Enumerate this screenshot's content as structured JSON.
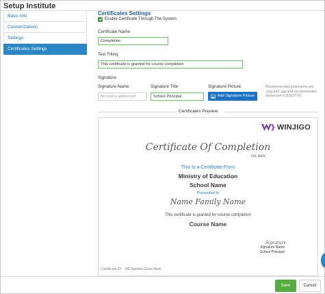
{
  "page": {
    "title": "Setup Institute"
  },
  "sidebar": {
    "items": [
      {
        "label": "Basic Info"
      },
      {
        "label": "Customizations"
      },
      {
        "label": "Settings"
      },
      {
        "label": "Certificates Settings",
        "active": true
      }
    ]
  },
  "certificates": {
    "section_title": "Certificates Settings",
    "enable_label": "Enable Certificate Through The System",
    "enable_checked": true,
    "certificate_name_label": "Certificate Name",
    "certificate_name_value": "Completion",
    "text_filling_label": "Text Filling",
    "text_filling_value": "This certificate is granted for course completion",
    "signature_section_label": "Signature",
    "signature_name_label": "Signature Name",
    "signature_name_placeholder": "No text is added yet",
    "signature_title_label": "Signature Title",
    "signature_title_value": "School Principal",
    "signature_picture_label": "Signature Picture",
    "add_signature_button": "Add Signature Picture",
    "hint": "Recommended extensions are .png and .jpg and recommended dimension is 83x37 PX"
  },
  "preview": {
    "label": "Certificates Preview",
    "logo_text": "WINJIGO",
    "title_script": "Certificate Of Completion",
    "on_date": "On date",
    "presented_from": "This Is a Certificate From",
    "ministry": "Ministry of Education",
    "school": "School Name",
    "presented_to": "Presented to",
    "recipient_script": "Name Family Name",
    "body_text": "This certificate is granted for course completion",
    "course": "Course Name",
    "signature_mark": "Signature",
    "signature_name": "Signature Name",
    "signature_title": "School Principal",
    "cert_id_label": "Certificate ID:",
    "cert_id_value": "#ID Number Goes Here"
  },
  "footer": {
    "save": "Save",
    "cancel": "Cancel"
  },
  "colors": {
    "accent_blue": "#2a86c5",
    "link_blue": "#1a73c8",
    "valid_green": "#69c06b",
    "save_green": "#54ad3e",
    "logo_purple": "#7b3aa6"
  }
}
